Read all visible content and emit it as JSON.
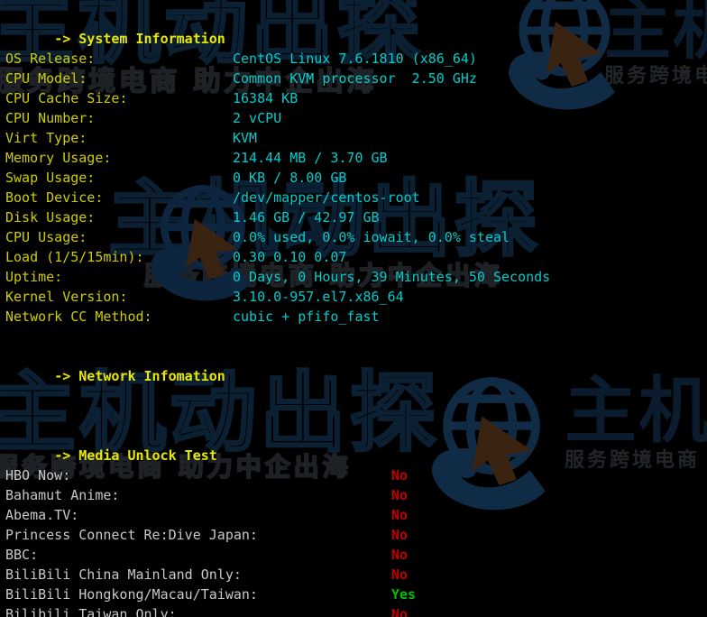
{
  "terminal": {
    "background": "#000000",
    "label_color": "#cdcd00",
    "value_color": "#00cdcd",
    "section_color": "#e8e800",
    "media_label_color": "#c8c8c8",
    "yes_color": "#00c000",
    "no_color": "#c00000"
  },
  "sections": {
    "system": {
      "header": "-> System Information"
    },
    "network": {
      "header": "-> Network Infomation"
    },
    "media": {
      "header": "-> Media Unlock Test"
    }
  },
  "system_info": [
    {
      "label": "OS Release:",
      "value": "CentOS Linux 7.6.1810 (x86_64)"
    },
    {
      "label": "CPU Model:",
      "value": "Common KVM processor  2.50 GHz"
    },
    {
      "label": "CPU Cache Size:",
      "value": "16384 KB"
    },
    {
      "label": "CPU Number:",
      "value": "2 vCPU"
    },
    {
      "label": "Virt Type:",
      "value": "KVM"
    },
    {
      "label": "Memory Usage:",
      "value": "214.44 MB / 3.70 GB"
    },
    {
      "label": "Swap Usage:",
      "value": "0 KB / 8.00 GB"
    },
    {
      "label": "Boot Device:",
      "value": "/dev/mapper/centos-root"
    },
    {
      "label": "Disk Usage:",
      "value": "1.46 GB / 42.97 GB"
    },
    {
      "label": "CPU Usage:",
      "value": "0.0% used, 0.0% iowait, 0.0% steal"
    },
    {
      "label": "Load (1/5/15min):",
      "value": "0.30 0.10 0.07"
    },
    {
      "label": "Uptime:",
      "value": "0 Days, 0 Hours, 39 Minutes, 50 Seconds"
    },
    {
      "label": "Kernel Version:",
      "value": "3.10.0-957.el7.x86_64"
    },
    {
      "label": "Network CC Method:",
      "value": "cubic + pfifo_fast"
    }
  ],
  "media_tests": [
    {
      "label": "HBO Now:",
      "result": "No"
    },
    {
      "label": "Bahamut Anime:",
      "result": "No"
    },
    {
      "label": "Abema.TV:",
      "result": "No"
    },
    {
      "label": "Princess Connect Re:Dive Japan:",
      "result": "No"
    },
    {
      "label": "BBC:",
      "result": "No"
    },
    {
      "label": "BiliBili China Mainland Only:",
      "result": "No"
    },
    {
      "label": "BiliBili Hongkong/Macau/Taiwan:",
      "result": "Yes"
    },
    {
      "label": "Bilibili Taiwan Only:",
      "result": "No"
    }
  ],
  "watermarks": {
    "brand_cjk": "主机",
    "brand_tagline": "服务跨境电商",
    "brand_tagline_long": "服务跨境电商 助力中企出海",
    "brand_outline": "主机动出探"
  }
}
